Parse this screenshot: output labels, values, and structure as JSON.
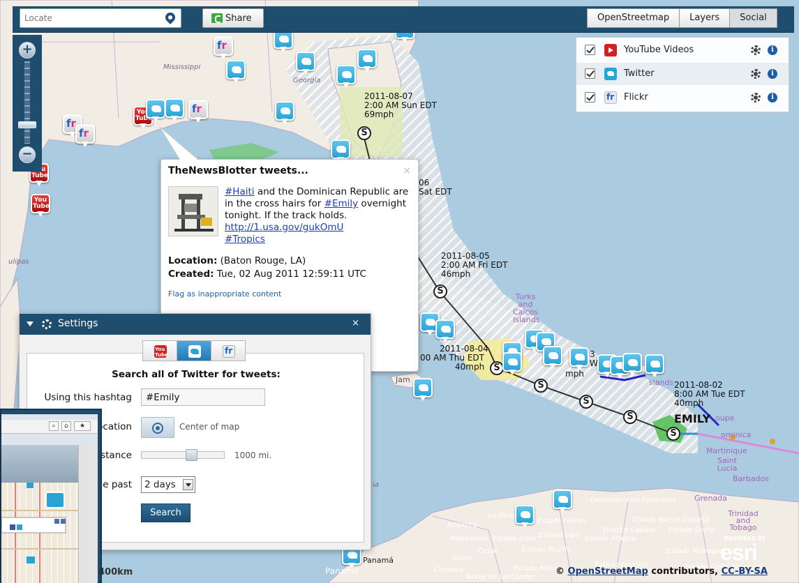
{
  "topbar": {
    "locate_placeholder": "Locate",
    "share_label": "Share",
    "tabs": [
      "OpenStreetmap",
      "Layers",
      "Social"
    ],
    "active_tab": "Social"
  },
  "social_layers": [
    {
      "label": "YouTube Videos",
      "icon": "youtube-icon",
      "checked": true
    },
    {
      "label": "Twitter",
      "icon": "twitter-icon",
      "checked": true
    },
    {
      "label": "Flickr",
      "icon": "flickr-icon",
      "checked": true
    }
  ],
  "zoom": {
    "in_label": "+",
    "out_label": "−",
    "level_fraction": 0.2
  },
  "popup": {
    "title": "TheNewsBlotter tweets...",
    "close": "×",
    "links": {
      "haiti": "#Haiti",
      "emily": "#Emily",
      "url": "http://1.usa.gov/gukOmU",
      "tropics": "#Tropics"
    },
    "text": {
      "part1": " and the Dominican Republic are in the cross hairs for ",
      "part2": " overnight tonight. If the track holds. "
    },
    "location_label": "Location:",
    "location_value": " (Baton Rouge, LA)",
    "created_label": "Created:",
    "created_value": " Tue, 02 Aug 2011 12:59:11 UTC",
    "flag_label": "Flag as inappropriate content"
  },
  "settings": {
    "title": "Settings",
    "close": "×",
    "active_service": "twitter",
    "search_title": "Search all of Twitter for tweets:",
    "hashtag_label": "Using this hashtag",
    "hashtag_value": "#Emily",
    "location_label": "ocation",
    "location_value": "Center of map",
    "distance_label": "stance",
    "distance_value": "1000 mi.",
    "distance_fraction": 0.62,
    "past_label": "he past",
    "past_value": "2 days",
    "search_button": "Search"
  },
  "storm": {
    "name": "EMILY",
    "points": [
      {
        "date": "2011-08-07",
        "time": "2:00 AM Sun EDT",
        "speed": "69mph"
      },
      {
        "date": "06",
        "time": "Sat EDT",
        "speed": ""
      },
      {
        "date": "2011-08-05",
        "time": "2:00 AM Fri EDT",
        "speed": "46mph"
      },
      {
        "date": "2011-08-04",
        "time": "00 AM Thu EDT",
        "speed": "40mph"
      },
      {
        "date": "3",
        "time": "We",
        "speed": "mph"
      },
      {
        "date": "2011-08-02",
        "time": "8:00 AM Tue EDT",
        "speed": "40mph"
      }
    ],
    "marker_symbol": "S"
  },
  "map_labels": {
    "mississippi": "Mississippi",
    "georgia": "Georgia",
    "tulipas": "ulipas",
    "turks": "Turks and Caicos Islands",
    "jam": "Jam",
    "islands": "slands",
    "oupe": "oupe",
    "dominica": "ominica",
    "martinique": "Martinique",
    "saint_lucia": "Saint Lucia",
    "barbados": "Barbados",
    "grenada": "Grenada",
    "trinidad": "Trinidad and Tobago",
    "dependencias": "Dependencias Federales",
    "distrito": "Distrito Capital",
    "nueva_esparta": "Estado Nueva Esparta",
    "sucre_estado": "Estado Sucre",
    "falcon": "Estado Falcon",
    "la_guaj": "La Guaj",
    "atlantico": "Atlántico",
    "magdalena": "Magdalena",
    "zulia": "Estado Zulia",
    "lara": "Estado Lara",
    "aragua": "Estado Aragua",
    "cesar": "Cesar",
    "trujillo": "Estado Trujillo",
    "monagas": "Estado Monagas",
    "sucre": "Sucre",
    "guarico": "Estado Guárico",
    "delta": "Estado Delta Amacuro",
    "merida": "Estado Mérida",
    "cordoba": "Córdoba",
    "santander": "Norte de Santander",
    "panama_city": "Panamá",
    "panama": "Panama",
    "ia": "ia"
  },
  "footer": {
    "scale": "400km",
    "attribution_prefix": "© ",
    "osm_link": "OpenStreetMap",
    "attribution_mid": " contributors, ",
    "license_link": "CC-BY-SA",
    "esri_powered": "POWERED BY",
    "esri_logo": "esri"
  },
  "colors": {
    "ui_navy": "#1e4d6e",
    "twitter_blue": "#2aa3d6",
    "youtube_red": "#d42020",
    "flickr_blue": "#2160c4",
    "flickr_pink": "#e3278f",
    "land": "#f2ede4",
    "water": "#aacbe0"
  }
}
